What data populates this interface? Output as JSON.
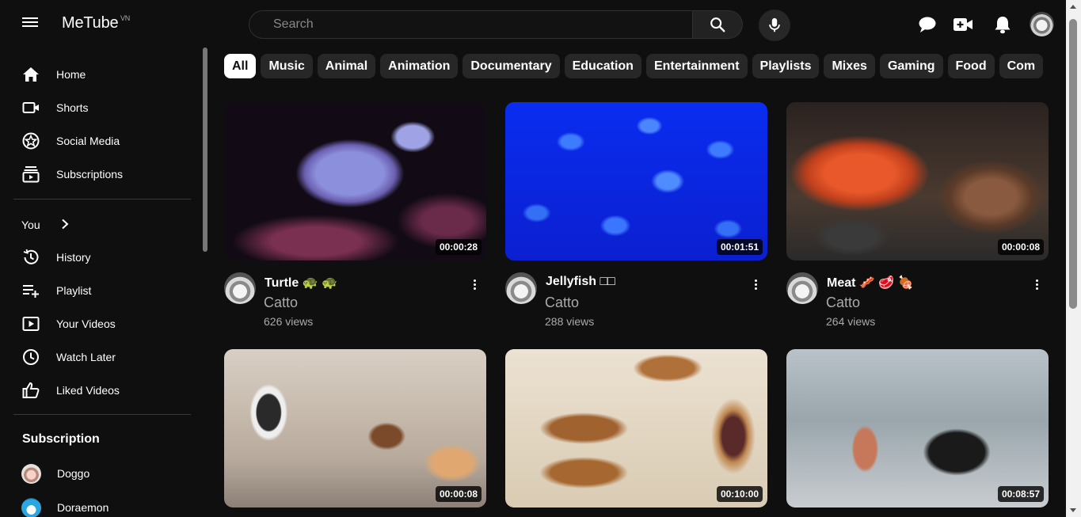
{
  "app": {
    "logo": "MeTube",
    "logo_sup": "VN"
  },
  "header": {
    "search_placeholder": "Search",
    "icons": [
      "menu-icon",
      "search-icon",
      "mic-icon",
      "chat-icon",
      "create-video-icon",
      "bell-icon",
      "avatar"
    ]
  },
  "sidebar": {
    "main": [
      {
        "label": "Home",
        "icon": "home-icon"
      },
      {
        "label": "Shorts",
        "icon": "shorts-icon"
      },
      {
        "label": "Social Media",
        "icon": "star-icon"
      },
      {
        "label": "Subscriptions",
        "icon": "subscriptions-icon"
      }
    ],
    "you_label": "You",
    "you_items": [
      {
        "label": "History",
        "icon": "history-icon"
      },
      {
        "label": "Playlist",
        "icon": "playlist-add-icon"
      },
      {
        "label": "Your Videos",
        "icon": "your-videos-icon"
      },
      {
        "label": "Watch Later",
        "icon": "clock-icon"
      },
      {
        "label": "Liked Videos",
        "icon": "thumbs-up-icon"
      }
    ],
    "subscription_heading": "Subscription",
    "subscriptions": [
      {
        "label": "Doggo"
      },
      {
        "label": "Doraemon"
      }
    ]
  },
  "chips": [
    "All",
    "Music",
    "Animal",
    "Animation",
    "Documentary",
    "Education",
    "Entertainment",
    "Playlists",
    "Mixes",
    "Gaming",
    "Food",
    "Com"
  ],
  "active_chip": "All",
  "videos": [
    {
      "title": "Turtle 🐢 🐢",
      "channel": "Catto",
      "views": "626 views",
      "duration": "00:00:28"
    },
    {
      "title": "Jellyfish □□",
      "channel": "Catto",
      "views": "288 views",
      "duration": "00:01:51"
    },
    {
      "title": "Meat 🥓 🥩 🍖",
      "channel": "Catto",
      "views": "264 views",
      "duration": "00:00:08"
    },
    {
      "title": "",
      "channel": "",
      "views": "",
      "duration": "00:00:08"
    },
    {
      "title": "",
      "channel": "",
      "views": "",
      "duration": "00:10:00"
    },
    {
      "title": "",
      "channel": "",
      "views": "",
      "duration": "00:08:57"
    }
  ],
  "colors": {
    "background": "#0f0f0f",
    "chip": "#272727",
    "chip_active": "#ffffff",
    "muted_text": "#aaaaaa"
  }
}
